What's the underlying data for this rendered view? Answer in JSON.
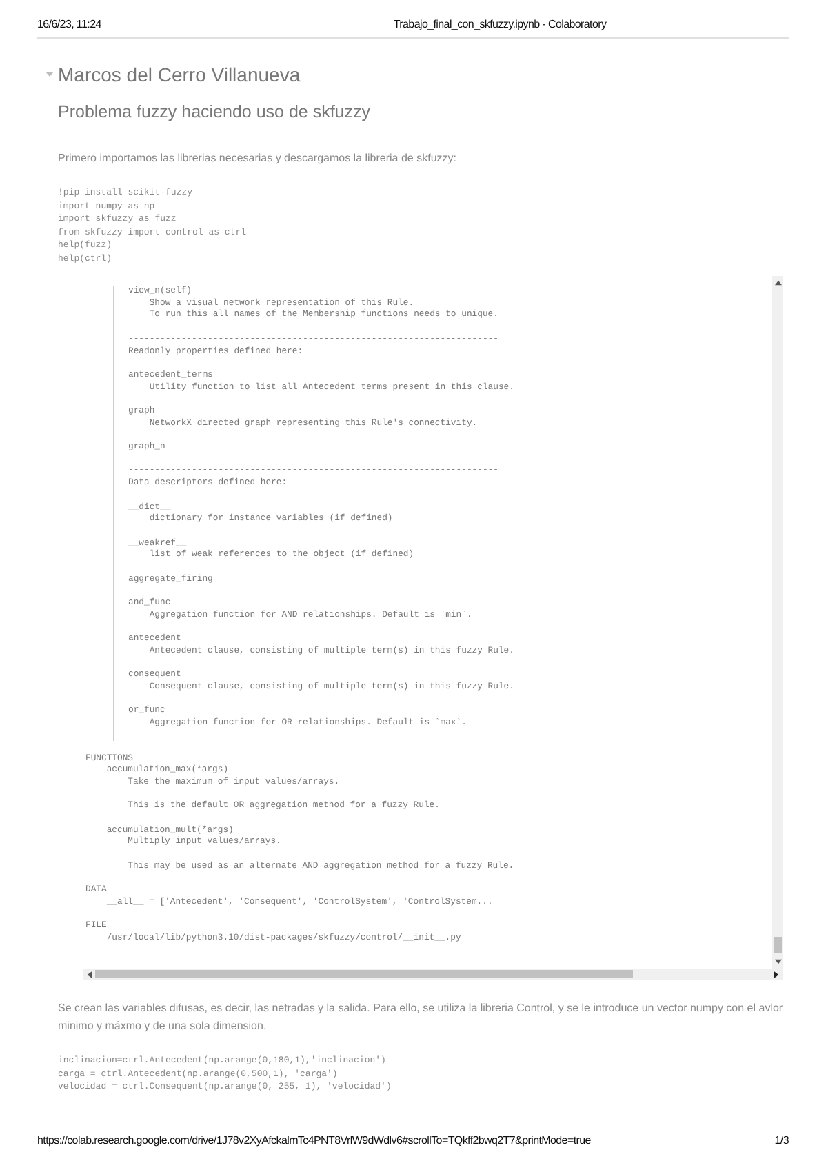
{
  "print_header": {
    "date": "16/6/23, 11:24",
    "title": "Trabajo_final_con_skfuzzy.ipynb - Colaboratory"
  },
  "heading": "Marcos del Cerro Villanueva",
  "subheading": "Problema fuzzy haciendo uso de skfuzzy",
  "intro": "Primero importamos las librerias necesarias y descargamos la libreria de skfuzzy:",
  "code_cell_1": [
    "!pip install scikit-fuzzy",
    "import numpy as np",
    "import skfuzzy as fuzz",
    "from skfuzzy import control as ctrl",
    "help(fuzz)",
    "help(ctrl)"
  ],
  "output": {
    "sections": [
      {
        "kind": "ruled",
        "blocks": [
          [
            "view_n(self)",
            "    Show a visual network representation of this Rule.",
            "    To run this all names of the Membership functions needs to unique."
          ],
          [
            "----------------------------------------------------------------------",
            "Readonly properties defined here:"
          ],
          [
            "antecedent_terms",
            "    Utility function to list all Antecedent terms present in this clause."
          ],
          [
            "graph",
            "    NetworkX directed graph representing this Rule's connectivity."
          ],
          [
            "graph_n"
          ],
          [
            "----------------------------------------------------------------------",
            "Data descriptors defined here:"
          ],
          [
            "__dict__",
            "    dictionary for instance variables (if defined)"
          ],
          [
            "__weakref__",
            "    list of weak references to the object (if defined)"
          ],
          [
            "aggregate_firing"
          ],
          [
            "and_func",
            "    Aggregation function for AND relationships. Default is `min`."
          ],
          [
            "antecedent",
            "    Antecedent clause, consisting of multiple term(s) in this fuzzy Rule."
          ],
          [
            "consequent",
            "    Consequent clause, consisting of multiple term(s) in this fuzzy Rule."
          ],
          [
            "or_func",
            "    Aggregation function for OR relationships. Default is `max`."
          ]
        ]
      },
      {
        "kind": "plain",
        "blocks": [
          [
            "FUNCTIONS",
            "    accumulation_max(*args)",
            "        Take the maximum of input values/arrays."
          ],
          [
            "        This is the default OR aggregation method for a fuzzy Rule."
          ],
          [
            "    accumulation_mult(*args)",
            "        Multiply input values/arrays."
          ],
          [
            "        This may be used as an alternate AND aggregation method for a fuzzy Rule."
          ],
          [
            "DATA",
            "    __all__ = ['Antecedent', 'Consequent', 'ControlSystem', 'ControlSystem..."
          ],
          [
            "FILE",
            "    /usr/local/lib/python3.10/dist-packages/skfuzzy/control/__init__.py"
          ]
        ]
      }
    ]
  },
  "explanation": "Se crean las variables difusas, es decir, las netradas y la salida. Para ello, se utiliza la libreria Control, y se le introduce un vector numpy con el avlor minimo y máxmo y de una sola dimension.",
  "code_cell_2": [
    "inclinacion=ctrl.Antecedent(np.arange(0,180,1),'inclinacion')",
    "carga = ctrl.Antecedent(np.arange(0,500,1), 'carga')",
    "velocidad = ctrl.Consequent(np.arange(0, 255, 1), 'velocidad')"
  ],
  "print_footer": {
    "url": "https://colab.research.google.com/drive/1J78v2XyAfckalmTc4PNT8VrlW9dWdlv6#scrollTo=TQkff2bwq2T7&printMode=true",
    "page": "1/3"
  }
}
